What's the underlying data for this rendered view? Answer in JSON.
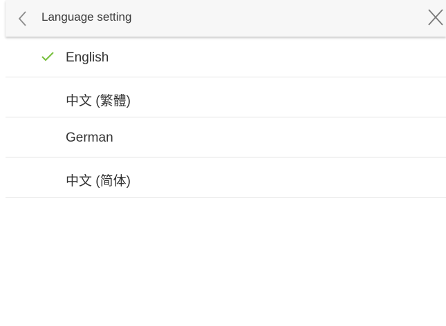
{
  "header": {
    "title": "Language setting",
    "back_icon": "chevron-left-icon",
    "close_icon": "close-icon"
  },
  "languages": {
    "items": [
      {
        "label": "English",
        "selected": true
      },
      {
        "label": "中文 (繁體)",
        "selected": false
      },
      {
        "label": "German",
        "selected": false
      },
      {
        "label": "中文 (简体)",
        "selected": false
      }
    ]
  },
  "colors": {
    "check": "#7bc142",
    "header_bg": "#f7f7f7",
    "icon": "#8a8a8a"
  }
}
